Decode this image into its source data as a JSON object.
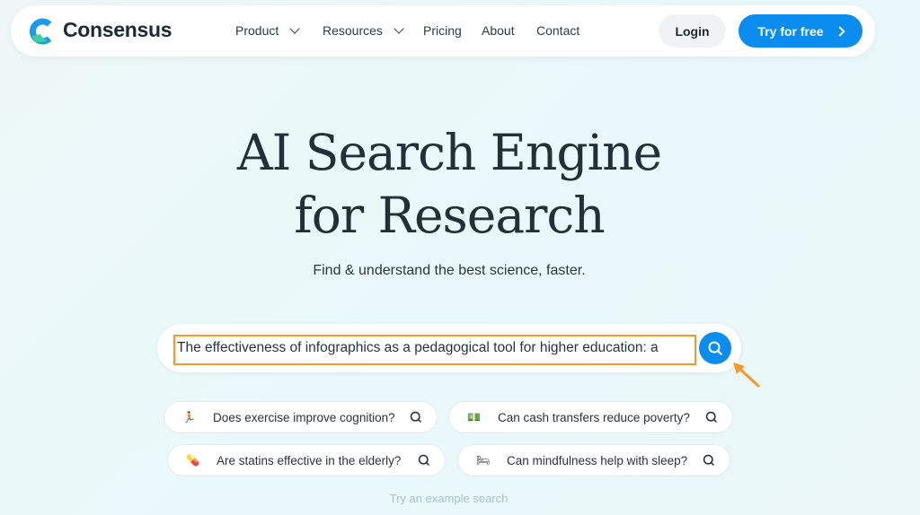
{
  "nav": {
    "brand": "Consensus",
    "items": [
      {
        "label": "Product",
        "dropdown": true
      },
      {
        "label": "Resources",
        "dropdown": true
      },
      {
        "label": "Pricing"
      },
      {
        "label": "About"
      },
      {
        "label": "Contact"
      }
    ],
    "login": "Login",
    "try_free": "Try for free"
  },
  "hero": {
    "title_line1": "AI Search Engine",
    "title_line2": "for Research",
    "subtitle": "Find & understand the best science, faster."
  },
  "search": {
    "value": "The effectiveness of infographics as a pedagogical tool for higher education: a"
  },
  "examples": [
    {
      "emoji": "🏃",
      "label": "Does exercise improve cognition?"
    },
    {
      "emoji": "💵",
      "label": "Can cash transfers reduce poverty?"
    },
    {
      "emoji": "💊",
      "label": "Are statins effective in the elderly?"
    },
    {
      "emoji": "🛏",
      "label": "Can mindfulness help with sleep?"
    }
  ],
  "try_example": "Try an example search",
  "colors": {
    "accent": "#0b8cef",
    "highlight": "#f39a27"
  }
}
